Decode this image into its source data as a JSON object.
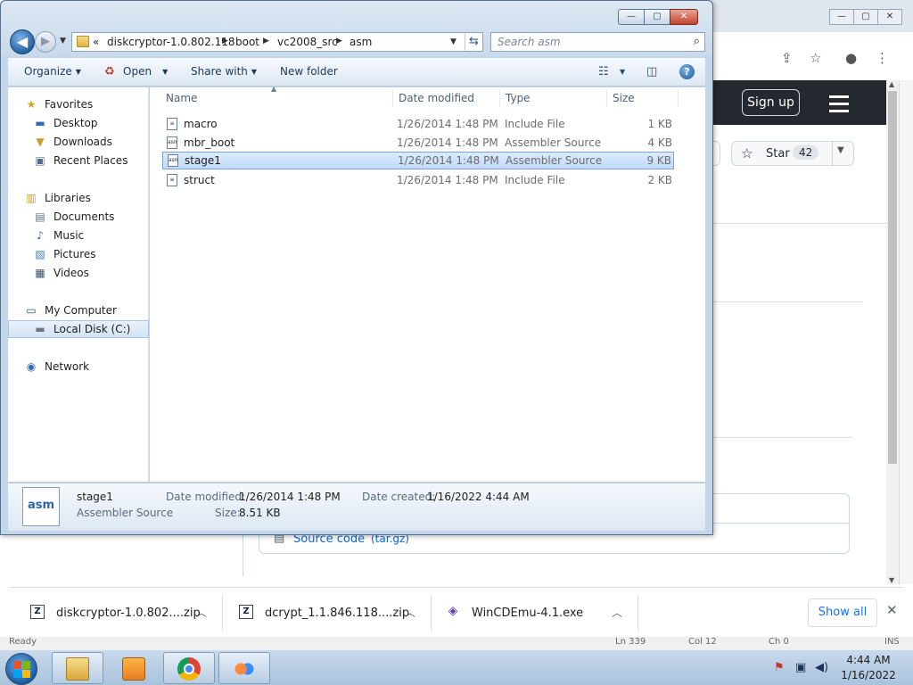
{
  "explorer": {
    "caption_buttons": {
      "minimize": "—",
      "maximize": "▢",
      "close": "✕"
    },
    "nav": {
      "back": "◀",
      "forward": "▶"
    },
    "breadcrumbs": [
      {
        "label": "«"
      },
      {
        "label": "diskcryptor-1.0.802.118"
      },
      {
        "label": "boot"
      },
      {
        "label": "vc2008_src"
      },
      {
        "label": "asm"
      }
    ],
    "search_placeholder": "Search asm",
    "toolbar": {
      "organize": "Organize",
      "open": "Open",
      "share_with": "Share with",
      "new_folder": "New folder",
      "help": "?"
    },
    "sidebar": {
      "favorites": {
        "label": "Favorites",
        "items": [
          "Desktop",
          "Downloads",
          "Recent Places"
        ]
      },
      "libraries": {
        "label": "Libraries",
        "items": [
          "Documents",
          "Music",
          "Pictures",
          "Videos"
        ]
      },
      "computer": {
        "label": "My Computer",
        "items": [
          "Local Disk (C:)"
        ]
      },
      "network": {
        "label": "Network"
      }
    },
    "columns": {
      "name": "Name",
      "date": "Date modified",
      "type": "Type",
      "size": "Size"
    },
    "files": [
      {
        "name": "macro",
        "date": "1/26/2014 1:48 PM",
        "type": "Include File",
        "size": "1 KB",
        "icon": "≡"
      },
      {
        "name": "mbr_boot",
        "date": "1/26/2014 1:48 PM",
        "type": "Assembler Source",
        "size": "4 KB",
        "icon": "asm"
      },
      {
        "name": "stage1",
        "date": "1/26/2014 1:48 PM",
        "type": "Assembler Source",
        "size": "9 KB",
        "icon": "asm"
      },
      {
        "name": "struct",
        "date": "1/26/2014 1:48 PM",
        "type": "Include File",
        "size": "2 KB",
        "icon": "≡"
      }
    ],
    "details": {
      "icon_text": "asm",
      "name": "stage1",
      "type": "Assembler Source",
      "date_modified_label": "Date modified:",
      "date_modified": "1/26/2014 1:48 PM",
      "date_created_label": "Date created:",
      "date_created": "1/16/2022 4:44 AM",
      "size_label": "Size:",
      "size": "8.51 KB"
    }
  },
  "browser": {
    "caption_buttons": {
      "minimize": "—",
      "maximize": "▢",
      "close": "✕"
    },
    "sign_up": "Sign up",
    "star": {
      "label": "Star",
      "count": "42"
    },
    "source_code": "Source code",
    "source_code_format": "(tar.gz)",
    "downloads": [
      {
        "name": "diskcryptor-1.0.802....zip",
        "icon": "Z"
      },
      {
        "name": "dcrypt_1.1.846.118....zip",
        "icon": "Z"
      },
      {
        "name": "WinCDEmu-4.1.exe",
        "icon": "◈"
      }
    ],
    "show_all": "Show all",
    "status": {
      "ready": "Ready",
      "ln": "Ln 339",
      "col": "Col 12",
      "ch": "Ch 0",
      "ins": "INS"
    }
  },
  "taskbar": {
    "clock_time": "4:44 AM",
    "clock_date": "1/16/2022"
  },
  "colors": {
    "selection": "#c1dbfb",
    "accent": "#1a73e8",
    "github_header": "#24292f"
  }
}
